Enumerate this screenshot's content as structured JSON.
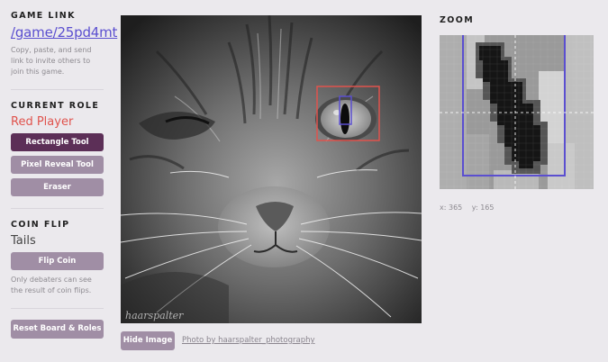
{
  "sidebar": {
    "game_link": {
      "heading": "GAME LINK",
      "link": "/game/25pd4mt",
      "hint": "Copy, paste, and send link to invite others to join this game."
    },
    "current_role": {
      "heading": "CURRENT ROLE",
      "role": "Red Player",
      "role_color": "#e0534d",
      "tools": [
        {
          "label": "Rectangle Tool",
          "active": true
        },
        {
          "label": "Pixel Reveal Tool",
          "active": false
        },
        {
          "label": "Eraser",
          "active": false
        }
      ]
    },
    "coin_flip": {
      "heading": "COIN FLIP",
      "result": "Tails",
      "button": "Flip Coin",
      "hint": "Only debaters can see the result of coin flips."
    },
    "reset_button": "Reset Board & Roles"
  },
  "image": {
    "hide_button": "Hide Image",
    "credit": "Photo by haarspalter_photography",
    "watermark": "haarspalter",
    "red_rect_color": "#e0534d",
    "blue_rect_color": "#5b4fd0"
  },
  "zoom": {
    "heading": "ZOOM",
    "x_label": "x: 365",
    "y_label": "y: 165"
  },
  "colors": {
    "accent": "#5b4fd0",
    "button": "#a08ea5",
    "button_active": "#5c2f57",
    "background": "#ebe9ed"
  }
}
